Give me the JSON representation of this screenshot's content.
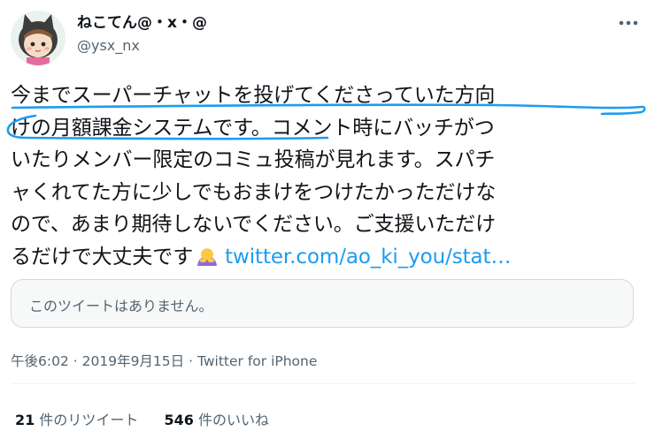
{
  "author": {
    "display_name": "ねこてん@・x・@",
    "handle": "@ysx_nx",
    "avatar": "cat-hood-girl-avatar"
  },
  "menu_icon": "more-horizontal-icon",
  "tweet": {
    "lines": [
      "今までスーパーチャットを投げてくださっていた方向",
      "けの月額課金システムです。コメント時にバッチがつ",
      "いたりメンバー限定のコミュ投稿が見れます。スパチ",
      "ャくれてた方に少しでもおまけをつけたかっただけな",
      "ので、あまり期待しないでください。ご支援いただけ",
      "るだけで大丈夫です"
    ],
    "emoji": "person-bowing-emoji",
    "link_text": "twitter.com/ao_ki_you/stat…",
    "link_color": "#1d9bf0",
    "highlight_color": "#1d9bf0"
  },
  "quoted": {
    "text": "このツイートはありません。"
  },
  "meta": {
    "time": "午後6:02",
    "separator_1": "·",
    "date": "2019年9月15日",
    "separator_2": "·",
    "source": "Twitter for iPhone"
  },
  "stats": {
    "retweets_count": "21",
    "retweets_label": "件のリツイート",
    "likes_count": "546",
    "likes_label": "件のいいね"
  }
}
